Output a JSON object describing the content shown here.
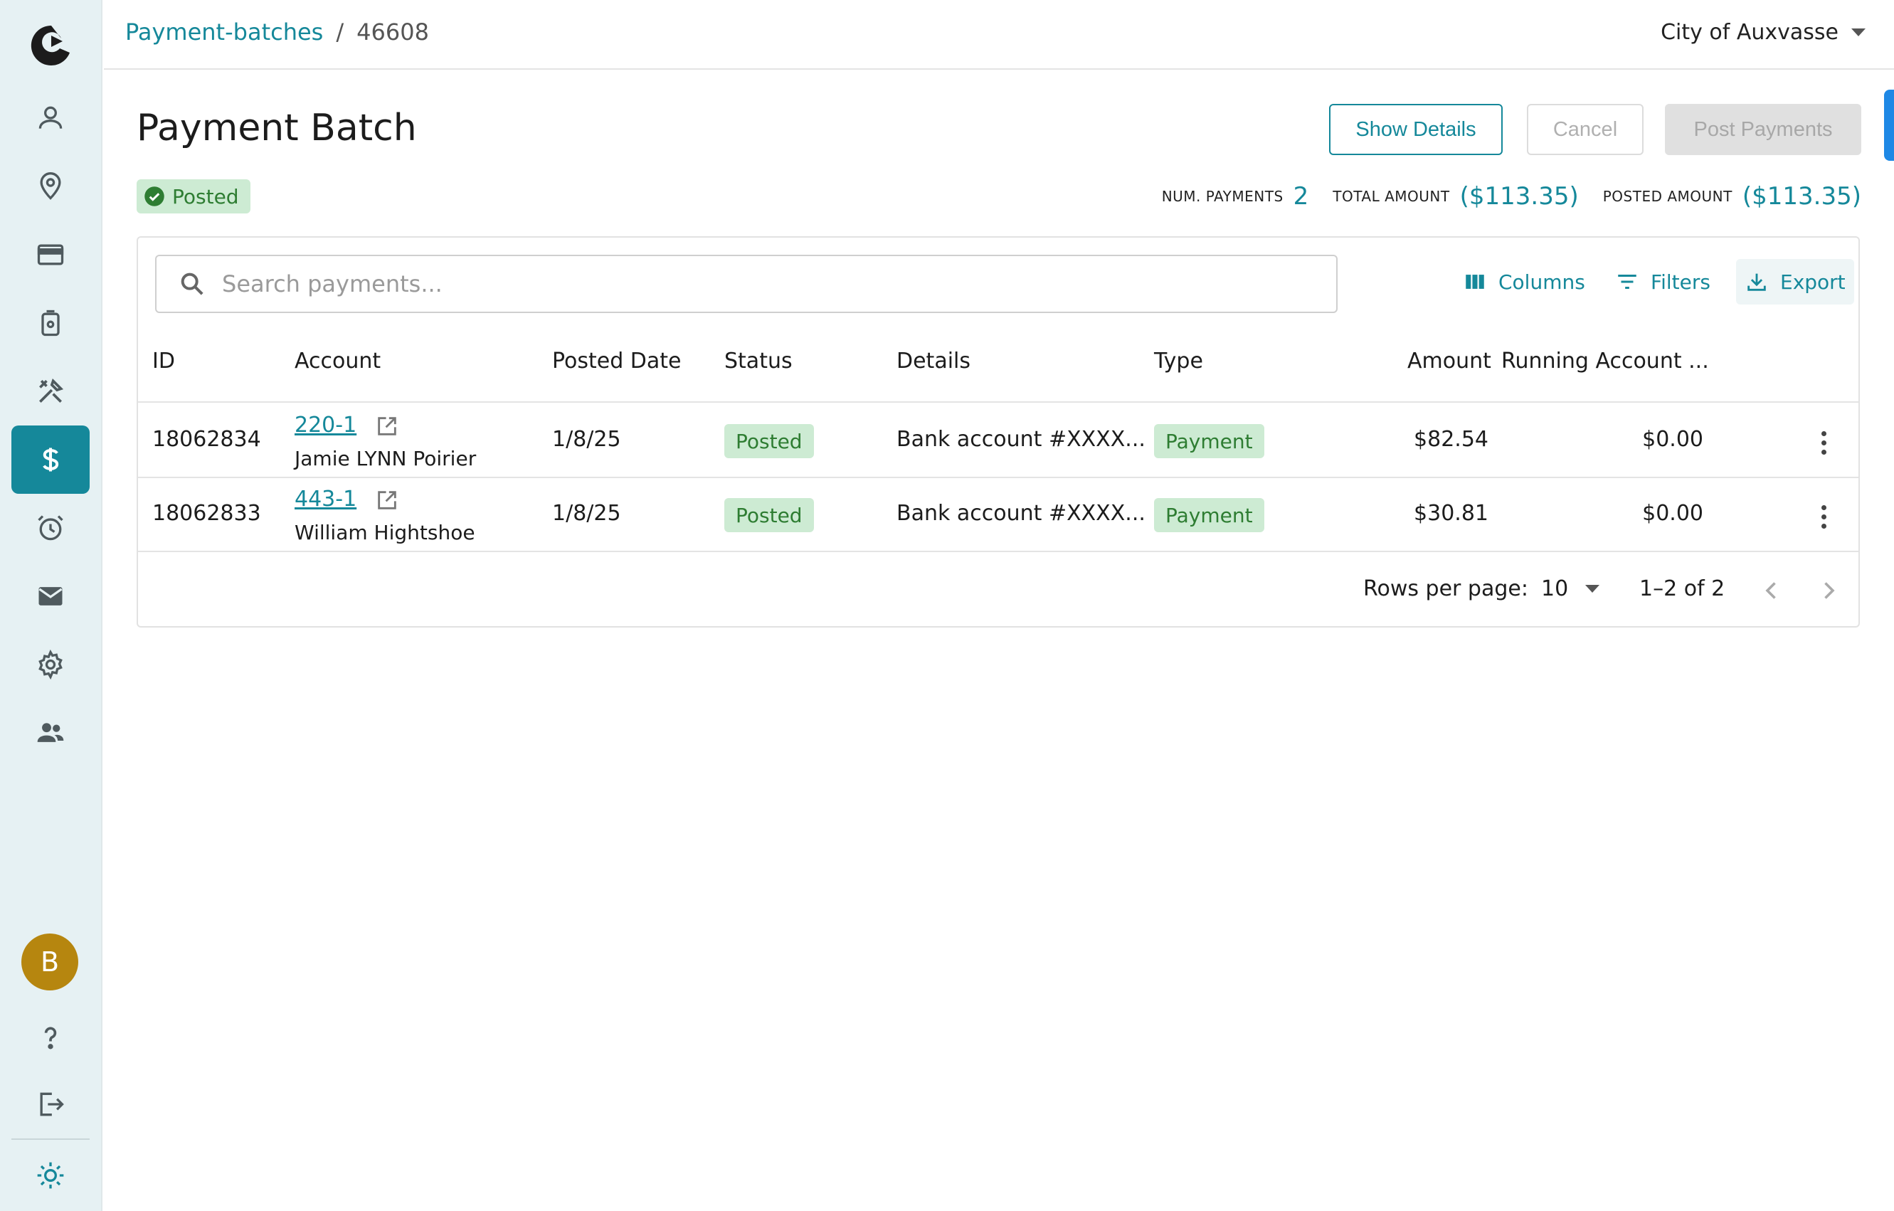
{
  "sidebar": {
    "items": [
      {
        "icon": "person-icon"
      },
      {
        "icon": "location-pin-icon"
      },
      {
        "icon": "credit-card-icon"
      },
      {
        "icon": "meter-icon"
      },
      {
        "icon": "tools-icon"
      },
      {
        "icon": "dollar-icon",
        "active": true
      },
      {
        "icon": "alarm-clock-icon"
      },
      {
        "icon": "mail-icon"
      },
      {
        "icon": "gear-icon"
      },
      {
        "icon": "people-icon"
      }
    ],
    "avatar_initial": "B",
    "bottom": [
      {
        "icon": "help-icon"
      },
      {
        "icon": "logout-icon"
      },
      {
        "icon": "sun-icon"
      }
    ]
  },
  "topbar": {
    "breadcrumb": {
      "link": "Payment-batches",
      "separator": "/",
      "current": "46608"
    },
    "org": "City of Auxvasse"
  },
  "header": {
    "title": "Payment Batch",
    "status": "Posted",
    "buttons": {
      "show_details": "Show Details",
      "cancel": "Cancel",
      "post_payments": "Post Payments"
    },
    "stats": {
      "num_payments_label": "NUM. PAYMENTS",
      "num_payments": "2",
      "total_amount_label": "TOTAL AMOUNT",
      "total_amount": "($113.35)",
      "posted_amount_label": "POSTED AMOUNT",
      "posted_amount": "($113.35)"
    }
  },
  "grid": {
    "search_placeholder": "Search payments...",
    "toolbar": {
      "columns": "Columns",
      "filters": "Filters",
      "export": "Export"
    },
    "columns": [
      "ID",
      "Account",
      "Posted Date",
      "Status",
      "Details",
      "Type",
      "Amount",
      "Running Account ..."
    ],
    "rows": [
      {
        "id": "18062834",
        "account": "220-1",
        "name": "Jamie LYNN Poirier",
        "posted_date": "1/8/25",
        "status": "Posted",
        "details": "Bank account #XXXX...",
        "type": "Payment",
        "amount": "$82.54",
        "running": "$0.00"
      },
      {
        "id": "18062833",
        "account": "443-1",
        "name": "William Hightshoe",
        "posted_date": "1/8/25",
        "status": "Posted",
        "details": "Bank account #XXXX...",
        "type": "Payment",
        "amount": "$30.81",
        "running": "$0.00"
      }
    ],
    "footer": {
      "rows_per_page_label": "Rows per page:",
      "rows_per_page": "10",
      "range": "1–2 of 2"
    }
  },
  "colors": {
    "accent": "#15889a",
    "success_bg": "#cdebd3",
    "success_text": "#2e7d32",
    "avatar": "#b6860f"
  }
}
